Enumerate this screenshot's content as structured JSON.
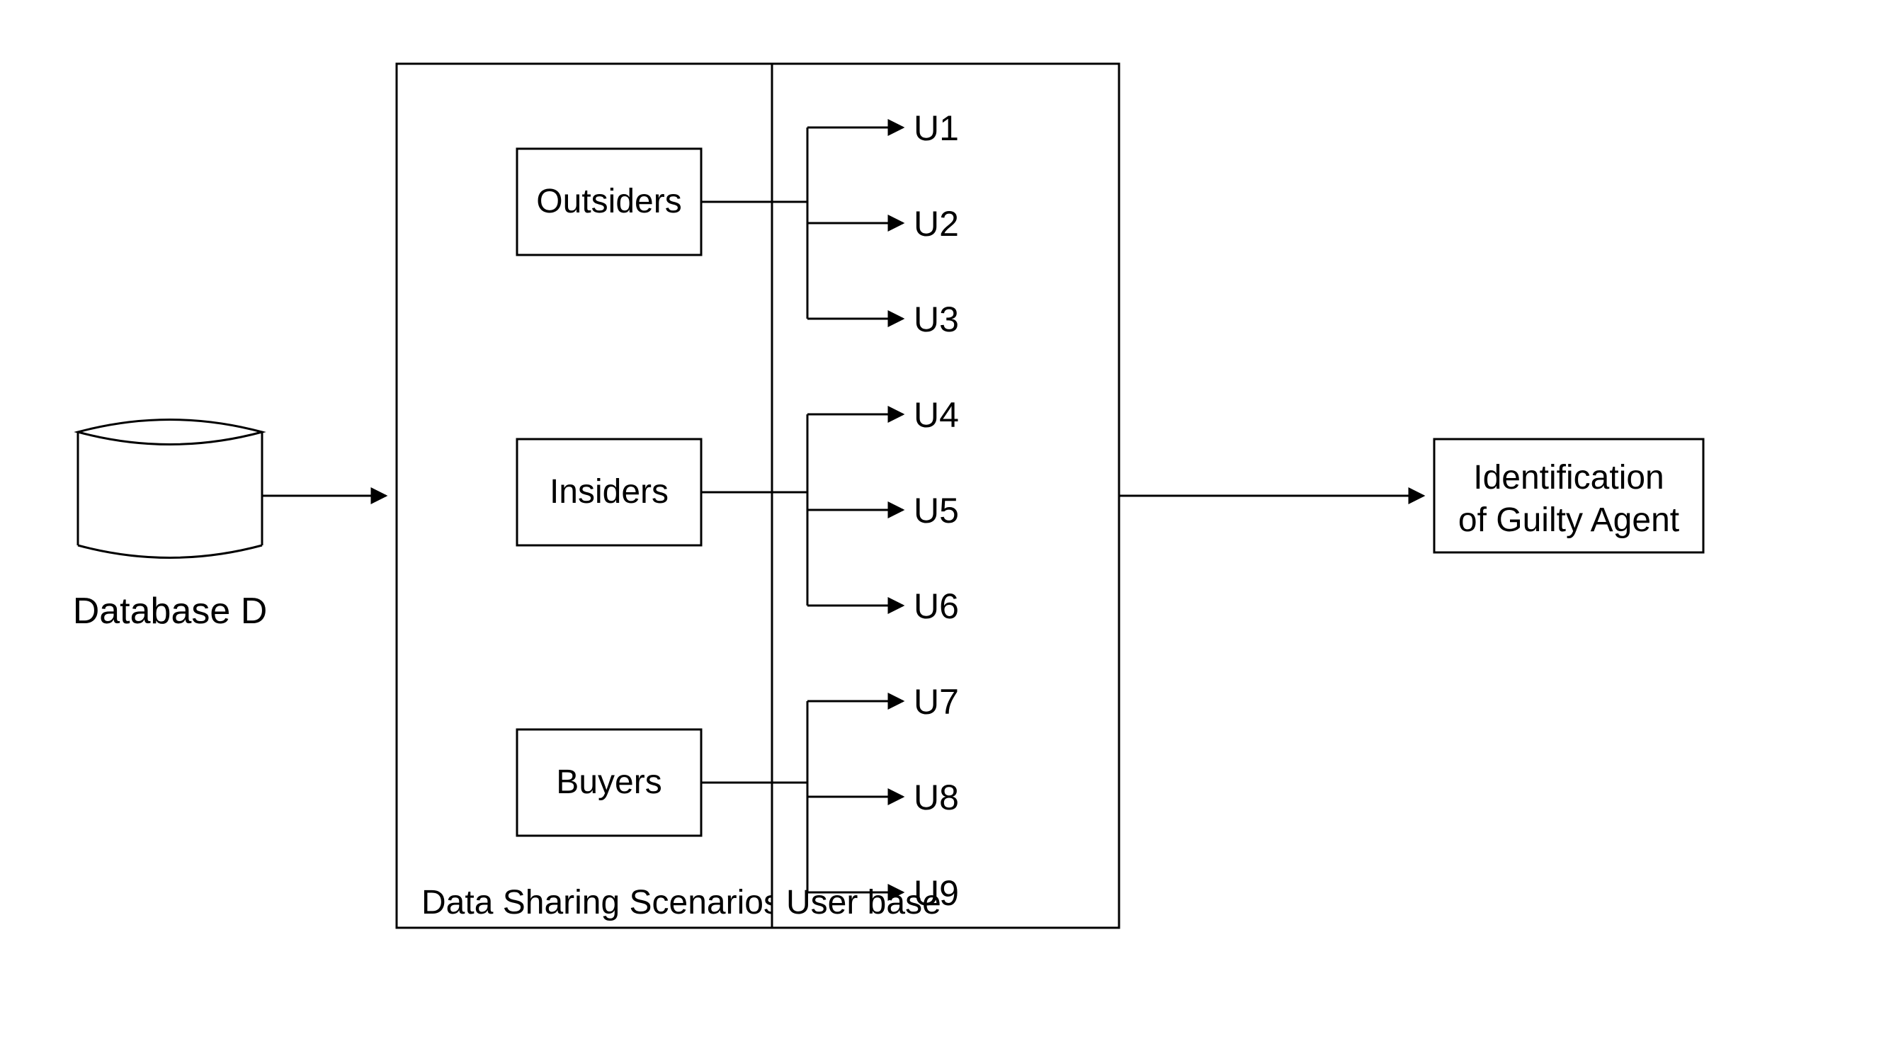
{
  "database": {
    "label": "Database D"
  },
  "scenarios": {
    "title": "Data Sharing Scenarios",
    "groups": [
      {
        "label": "Outsiders"
      },
      {
        "label": "Insiders"
      },
      {
        "label": "Buyers"
      }
    ]
  },
  "userbase": {
    "title": "User base",
    "users": [
      "U1",
      "U2",
      "U3",
      "U4",
      "U5",
      "U6",
      "U7",
      "U8",
      "U9"
    ]
  },
  "result": {
    "line1": "Identification",
    "line2": "of Guilty Agent"
  }
}
